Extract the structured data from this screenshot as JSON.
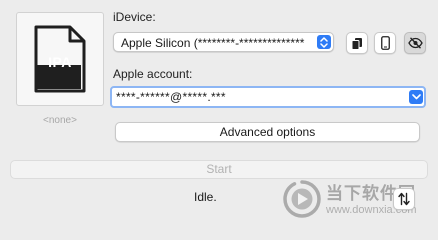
{
  "ipa_well": {
    "file_type": "IPA",
    "selection": "<none>"
  },
  "idevice": {
    "label": "iDevice:",
    "selected": "Apple Silicon (********-**************"
  },
  "device_actions": {
    "copy_icon": "copy-icon",
    "device_icon": "iphone-icon",
    "hide_icon": "eye-slash-icon"
  },
  "account": {
    "label": "Apple account:",
    "value": "****-******@*****.***"
  },
  "buttons": {
    "advanced": "Advanced options",
    "start": "Start"
  },
  "status": "Idle.",
  "sort_icon": "up-down-arrows-icon",
  "watermark": {
    "title": "当下软件园",
    "url": "www.downxia.com"
  },
  "colors": {
    "accent": "#2f7cf6",
    "focus_ring": "#8db6f4",
    "window_bg": "#ececec",
    "disabled_text": "#b2b2b2"
  }
}
